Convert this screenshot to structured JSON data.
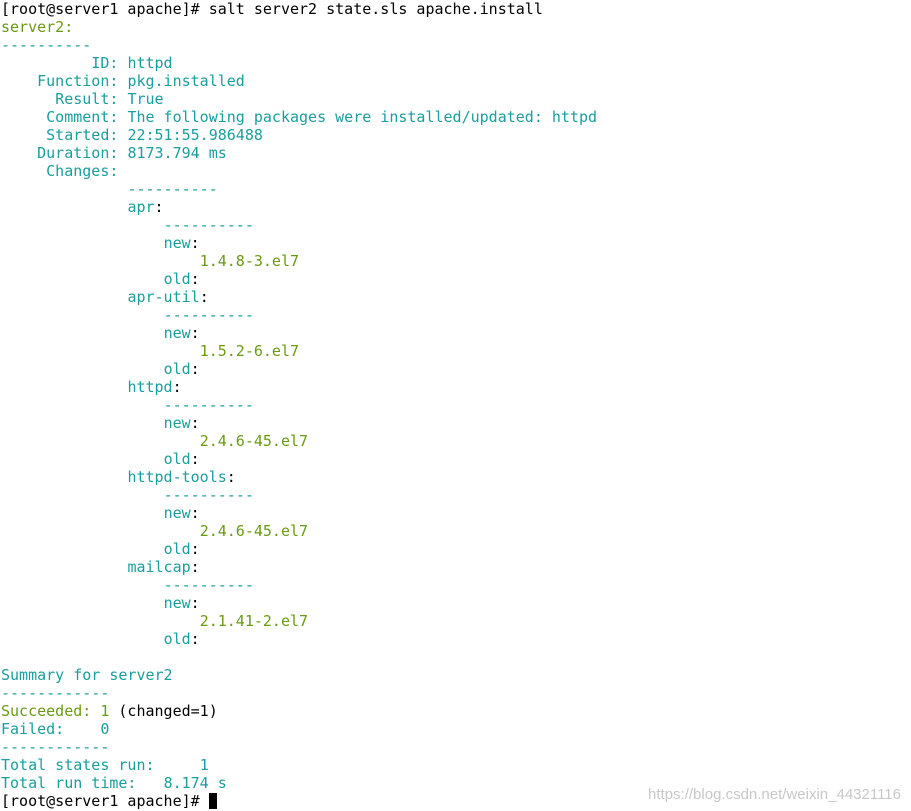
{
  "command_line": {
    "prompt": "[root@server1 apache]# ",
    "command": "salt server2 state.sls apache.install"
  },
  "minion": "server2:",
  "separator_long": "----------",
  "result": {
    "id_label": "ID:",
    "id_value": "httpd",
    "function_label": "Function:",
    "function_value": "pkg.installed",
    "result_label": "Result:",
    "result_value": "True",
    "comment_label": "Comment:",
    "comment_value": "The following packages were installed/updated: httpd",
    "started_label": "Started:",
    "started_value": "22:51:55.986488",
    "duration_label": "Duration:",
    "duration_value": "8173.794 ms",
    "changes_label": "Changes:"
  },
  "packages": [
    {
      "name": "apr",
      "new_label": "new",
      "new_value": "1.4.8-3.el7",
      "old_label": "old"
    },
    {
      "name": "apr-util",
      "new_label": "new",
      "new_value": "1.5.2-6.el7",
      "old_label": "old"
    },
    {
      "name": "httpd",
      "new_label": "new",
      "new_value": "2.4.6-45.el7",
      "old_label": "old"
    },
    {
      "name": "httpd-tools",
      "new_label": "new",
      "new_value": "2.4.6-45.el7",
      "old_label": "old"
    },
    {
      "name": "mailcap",
      "new_label": "new",
      "new_value": "2.1.41-2.el7",
      "old_label": "old"
    }
  ],
  "summary": {
    "title": "Summary for server2",
    "separator": "------------",
    "succeeded_label": "Succeeded:",
    "succeeded_value": "1",
    "changed_text": "(changed=1)",
    "failed_label": "Failed:",
    "failed_value": "0",
    "total_states_label": "Total states run:",
    "total_states_value": "1",
    "total_time_label": "Total run time:",
    "total_time_value": "8.174 s"
  },
  "final_prompt": "[root@server1 apache]# ",
  "watermark": "https://blog.csdn.net/weixin_44321116",
  "colors": {
    "cyan": "#1a9e9e",
    "green": "#6a9a14",
    "text": "#000000",
    "background": "#ffffff"
  }
}
